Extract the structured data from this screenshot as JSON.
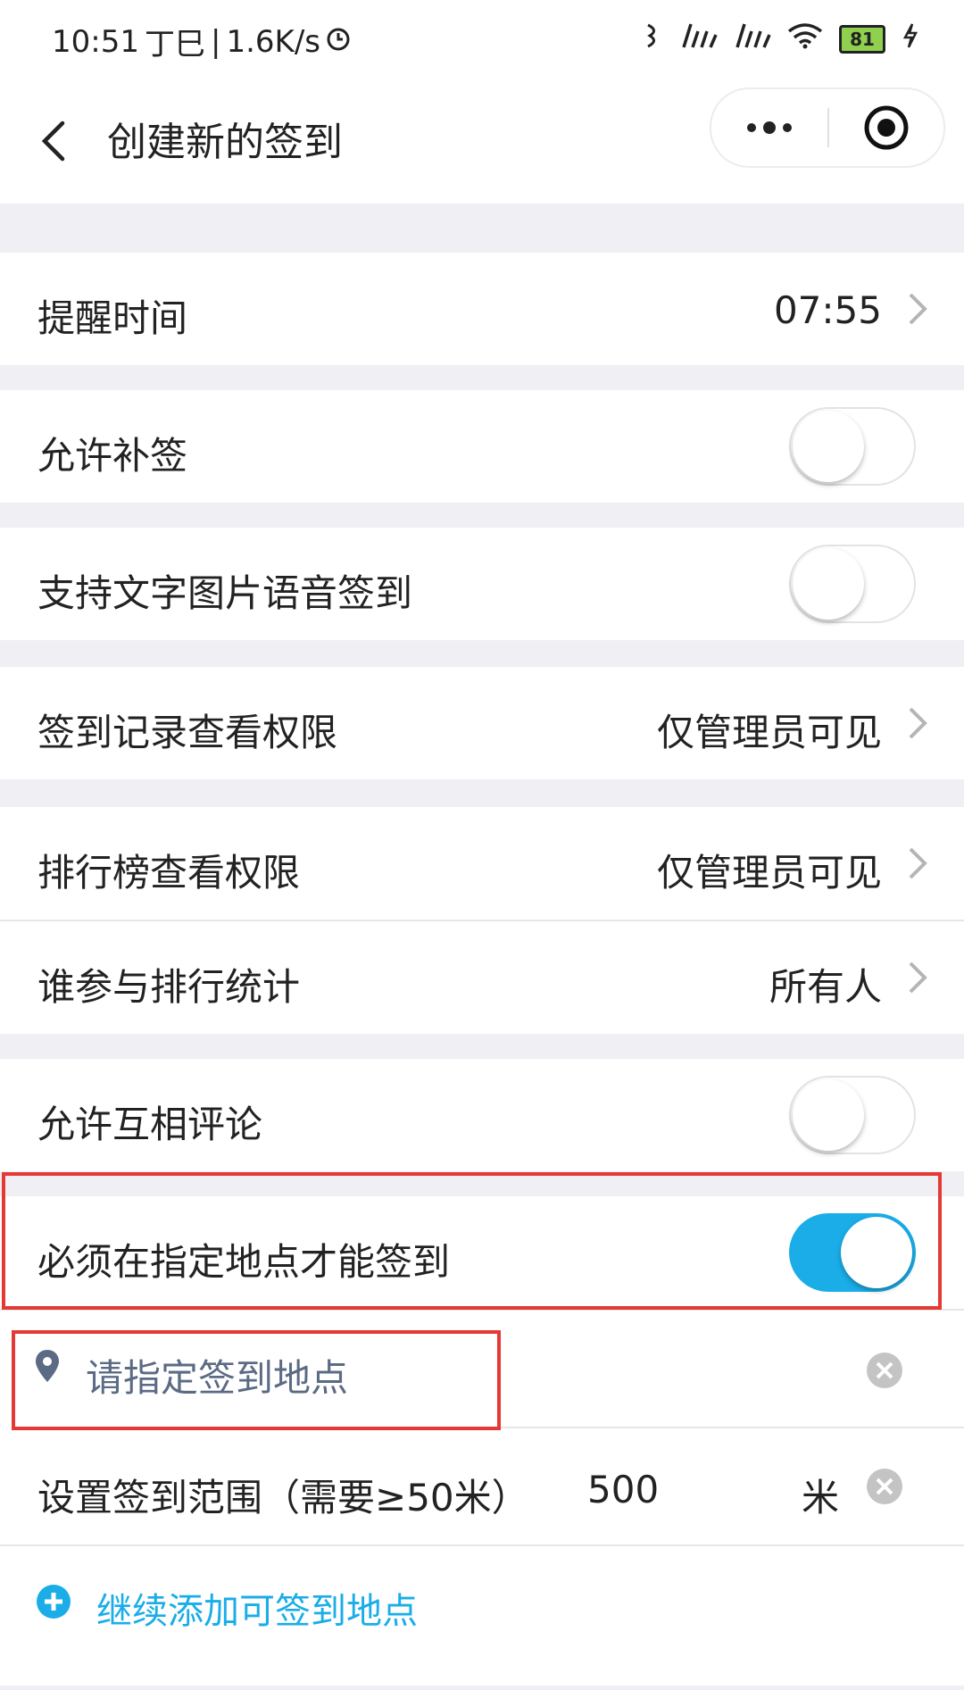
{
  "status_bar": {
    "time": "10:51",
    "lunar": "丁巳",
    "speed": "1.6K/s",
    "battery": "81"
  },
  "nav": {
    "title": "创建新的签到"
  },
  "rows": {
    "remind_time": {
      "label": "提醒时间",
      "value": "07:55"
    },
    "allow_makeup": {
      "label": "允许补签",
      "on": false
    },
    "text_image_voice": {
      "label": "支持文字图片语音签到",
      "on": false
    },
    "record_permission": {
      "label": "签到记录查看权限",
      "value": "仅管理员可见"
    },
    "rank_permission": {
      "label": "排行榜查看权限",
      "value": "仅管理员可见"
    },
    "rank_participants": {
      "label": "谁参与排行统计",
      "value": "所有人"
    },
    "allow_comment": {
      "label": "允许互相评论",
      "on": false
    },
    "location_required": {
      "label": "必须在指定地点才能签到",
      "on": true
    },
    "location_input": {
      "placeholder": "请指定签到地点"
    },
    "range": {
      "label": "设置签到范围（需要≥50米）",
      "value": "500",
      "unit": "米"
    },
    "add_location": {
      "label": "继续添加可签到地点"
    }
  },
  "colors": {
    "accent": "#1aade8",
    "highlight_box": "#e53935",
    "placeholder_text": "#5b6b84"
  }
}
